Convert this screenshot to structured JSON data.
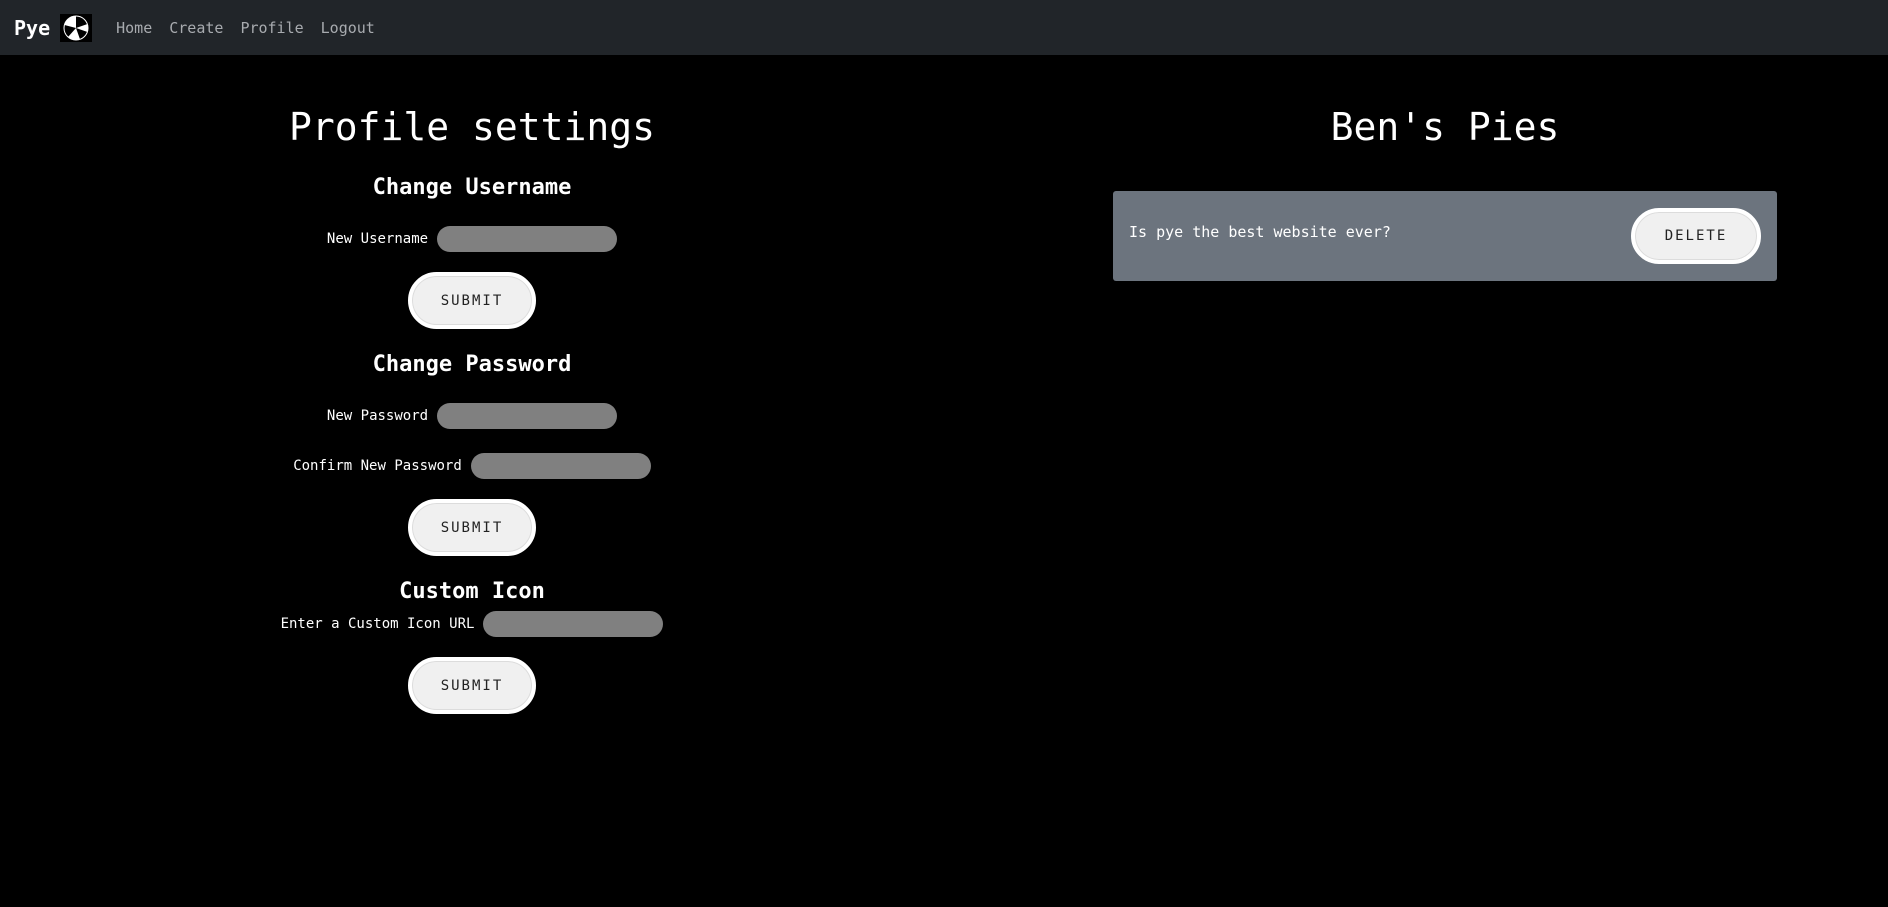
{
  "navbar": {
    "brand": "Pye",
    "logo_icon": "pie-chart-icon",
    "links": [
      "Home",
      "Create",
      "Profile",
      "Logout"
    ]
  },
  "profile": {
    "title": "Profile settings",
    "username": {
      "heading": "Change Username",
      "label": "New Username",
      "value": "",
      "submit_label": "SUBMIT"
    },
    "password": {
      "heading": "Change Password",
      "new_label": "New Password",
      "confirm_label": "Confirm New Password",
      "submit_label": "SUBMIT"
    },
    "icon": {
      "heading": "Custom Icon",
      "label": "Enter a Custom Icon URL",
      "submit_label": "SUBMIT"
    }
  },
  "pies": {
    "title": "Ben's Pies",
    "items": [
      {
        "question": "Is pye the best website ever?",
        "delete_label": "DELETE"
      }
    ]
  },
  "colors": {
    "navbar_bg": "#212529",
    "page_bg": "#000000",
    "card_bg": "#6c747e",
    "input_bg": "#808080",
    "button_bg": "#f0f0f0"
  }
}
